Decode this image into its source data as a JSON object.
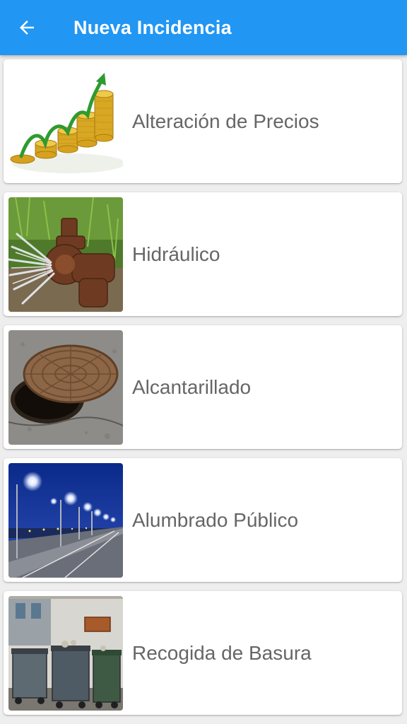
{
  "appbar": {
    "title": "Nueva Incidencia",
    "back_icon": "arrow-left-icon",
    "color": "#2196f3"
  },
  "categories": [
    {
      "label": "Alteración de Precios",
      "image": "rising-coins-chart-image"
    },
    {
      "label": "Hidráulico",
      "image": "leaking-water-valve-image"
    },
    {
      "label": "Alcantarillado",
      "image": "open-manhole-image"
    },
    {
      "label": "Alumbrado Público",
      "image": "street-lights-night-image"
    },
    {
      "label": "Recogida de Basura",
      "image": "garbage-containers-image"
    }
  ]
}
